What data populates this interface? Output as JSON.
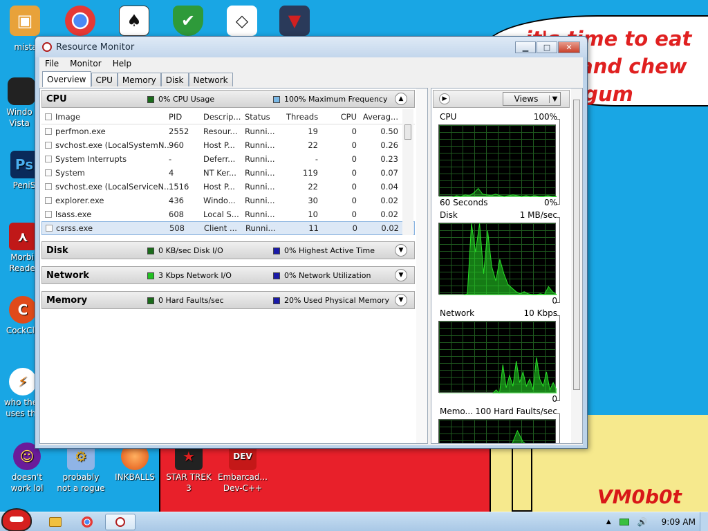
{
  "desktop": {
    "bubble_text": "it's time to eat shit and chew gum",
    "signature": "VM0b0t",
    "left_icons": [
      {
        "label": "mista",
        "icon": "folder-tools-icon"
      },
      {
        "label": "Windo Vista",
        "icon": "trash-bin-icon"
      },
      {
        "label": "PeniS",
        "icon": "photoshop-icon"
      },
      {
        "label": "Morbi Reade",
        "icon": "pdf-reader-icon"
      },
      {
        "label": "CockCle",
        "icon": "ccleaner-icon"
      },
      {
        "label": "who the uses th",
        "icon": "lightning-icon"
      }
    ],
    "bottom_icons": [
      {
        "label": "doesn't work lol",
        "icon": "yahoo-icon"
      },
      {
        "label": "probably not a rogue",
        "icon": "gears-icon"
      },
      {
        "label": "INKBALLS",
        "icon": "inkball-icon"
      },
      {
        "label": "STAR TREK 3",
        "icon": "star-trek-icon"
      },
      {
        "label": "Embarcad... Dev-C++",
        "icon": "devcpp-icon"
      }
    ],
    "top_icons": [
      "folder-icon",
      "chrome-icon",
      "solitaire-icon",
      "shield-icon",
      "unity-icon",
      "eagle-icon"
    ]
  },
  "window": {
    "title": "Resource Monitor",
    "menus": [
      "File",
      "Monitor",
      "Help"
    ],
    "tabs": [
      "Overview",
      "CPU",
      "Memory",
      "Disk",
      "Network"
    ],
    "active_tab": "Overview"
  },
  "cpu_section": {
    "title": "CPU",
    "metric1": "0% CPU Usage",
    "metric2": "100% Maximum Frequency",
    "metric1_color": "#1a6b1a",
    "metric2_color": "#7ab8e6",
    "columns": [
      "Image",
      "PID",
      "Descrip...",
      "Status",
      "Threads",
      "CPU",
      "Averag..."
    ],
    "rows": [
      {
        "image": "perfmon.exe",
        "pid": "2552",
        "desc": "Resour...",
        "status": "Runni...",
        "threads": "19",
        "cpu": "0",
        "avg": "0.50"
      },
      {
        "image": "svchost.exe (LocalSystemN...",
        "pid": "960",
        "desc": "Host P...",
        "status": "Runni...",
        "threads": "22",
        "cpu": "0",
        "avg": "0.26"
      },
      {
        "image": "System Interrupts",
        "pid": "-",
        "desc": "Deferr...",
        "status": "Runni...",
        "threads": "-",
        "cpu": "0",
        "avg": "0.23"
      },
      {
        "image": "System",
        "pid": "4",
        "desc": "NT Ker...",
        "status": "Runni...",
        "threads": "119",
        "cpu": "0",
        "avg": "0.07"
      },
      {
        "image": "svchost.exe (LocalServiceN...",
        "pid": "1516",
        "desc": "Host P...",
        "status": "Runni...",
        "threads": "22",
        "cpu": "0",
        "avg": "0.04"
      },
      {
        "image": "explorer.exe",
        "pid": "436",
        "desc": "Windo...",
        "status": "Runni...",
        "threads": "30",
        "cpu": "0",
        "avg": "0.02"
      },
      {
        "image": "lsass.exe",
        "pid": "608",
        "desc": "Local S...",
        "status": "Runni...",
        "threads": "10",
        "cpu": "0",
        "avg": "0.02"
      },
      {
        "image": "csrss.exe",
        "pid": "508",
        "desc": "Client ...",
        "status": "Runni...",
        "threads": "11",
        "cpu": "0",
        "avg": "0.02"
      }
    ]
  },
  "disk_section": {
    "title": "Disk",
    "metric1": "0 KB/sec Disk I/O",
    "metric2": "0% Highest Active Time",
    "metric1_color": "#1a6b1a",
    "metric2_color": "#1a1aa8"
  },
  "network_section": {
    "title": "Network",
    "metric1": "3 Kbps Network I/O",
    "metric2": "0% Network Utilization",
    "metric1_color": "#22c022",
    "metric2_color": "#1a1aa8"
  },
  "memory_section": {
    "title": "Memory",
    "metric1": "0 Hard Faults/sec",
    "metric2": "20% Used Physical Memory",
    "metric1_color": "#1a6b1a",
    "metric2_color": "#1a1aa8"
  },
  "right_panel": {
    "views_label": "Views",
    "graphs": [
      {
        "name": "CPU",
        "scale": "100%",
        "foot_left": "60 Seconds",
        "foot_right": "0%"
      },
      {
        "name": "Disk",
        "scale": "1 MB/sec",
        "foot_left": "",
        "foot_right": "0"
      },
      {
        "name": "Network",
        "scale": "10 Kbps",
        "foot_left": "",
        "foot_right": "0"
      },
      {
        "name": "Memo...",
        "scale": "100 Hard Faults/sec",
        "foot_left": "",
        "foot_right": ""
      }
    ]
  },
  "taskbar": {
    "clock": "9:09 AM"
  }
}
